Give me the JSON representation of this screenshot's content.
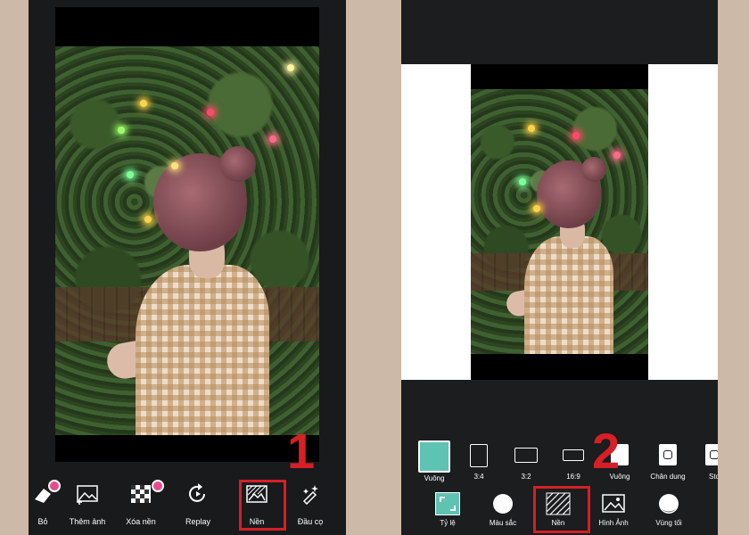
{
  "left_toolbar": {
    "items": [
      {
        "id": "bo",
        "label": "Bỏ"
      },
      {
        "id": "them-anh",
        "label": "Thêm ảnh"
      },
      {
        "id": "xoa-nen",
        "label": "Xóa nền"
      },
      {
        "id": "replay",
        "label": "Replay"
      },
      {
        "id": "nen",
        "label": "Nền"
      },
      {
        "id": "dau-co",
        "label": "Đầu cọ"
      }
    ]
  },
  "right_ratios": {
    "items": [
      {
        "id": "vuong",
        "label": "Vuông"
      },
      {
        "id": "3-4",
        "label": "3:4"
      },
      {
        "id": "3-2",
        "label": "3:2"
      },
      {
        "id": "16-9",
        "label": "16:9"
      },
      {
        "id": "vuong-ig",
        "label": "Vuông"
      },
      {
        "id": "chan-dung",
        "label": "Chân dung"
      },
      {
        "id": "sto",
        "label": "Sto"
      }
    ]
  },
  "right_toolbar": {
    "items": [
      {
        "id": "ty-le",
        "label": "Tỷ lệ"
      },
      {
        "id": "mau-sac",
        "label": "Màu sắc"
      },
      {
        "id": "nen",
        "label": "Nền"
      },
      {
        "id": "hinh-anh",
        "label": "Hình Ảnh"
      },
      {
        "id": "vung-toi",
        "label": "Vùng tối"
      }
    ]
  },
  "steps": {
    "one": "1",
    "two": "2"
  },
  "colors": {
    "accent": "#d61f26",
    "teal": "#5fc3b3",
    "panel": "#181a1b",
    "background": "#cdb9a7"
  }
}
